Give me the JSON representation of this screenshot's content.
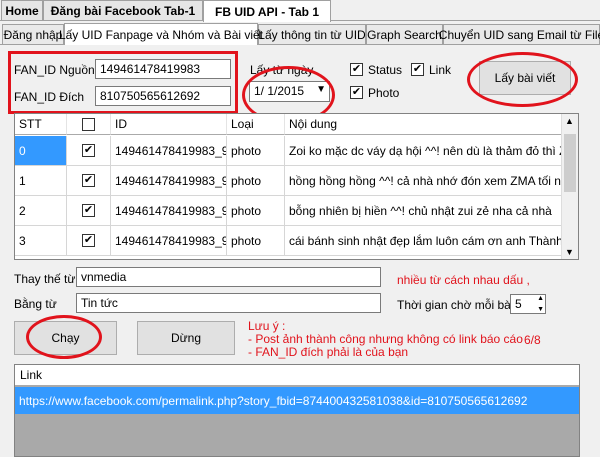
{
  "top_tabs": [
    "Home",
    "Đăng bài Facebook Tab-1",
    "FB UID API - Tab 1"
  ],
  "sub_tabs": [
    "Đăng nhập",
    "Lấy UID Fanpage và Nhóm và Bài viết",
    "Lấy thông tin từ UID",
    "Graph Search",
    "Chuyển UID sang Email từ File"
  ],
  "form": {
    "fan_id_source_label": "FAN_ID Nguồn",
    "fan_id_source_value": "149461478419983",
    "fan_id_dest_label": "FAN_ID Đích",
    "fan_id_dest_value": "810750565612692",
    "from_date_label": "Lấy từ ngày",
    "from_date_value": "1/  1/2015",
    "status_label": "Status",
    "link_label": "Link",
    "photo_label": "Photo",
    "get_posts_button": "Lấy bài viết"
  },
  "grid": {
    "headers": [
      "STT",
      "",
      "ID",
      "Loại",
      "Nội dung"
    ],
    "rows": [
      {
        "stt": "0",
        "id": "149461478419983_9...",
        "type": "photo",
        "content": "Zoi ko mặc dc váy dạ hội ^^! nên dù là thảm đỏ thì Z..."
      },
      {
        "stt": "1",
        "id": "149461478419983_9...",
        "type": "photo",
        "content": "hồng hồng hồng ^^! cả nhà nhớ đón xem ZMA tối na..."
      },
      {
        "stt": "2",
        "id": "149461478419983_9...",
        "type": "photo",
        "content": "bỗng nhiên bị hiền ^^! chủ nhật zui zẻ nha cả nhà"
      },
      {
        "stt": "3",
        "id": "149461478419983_9...",
        "type": "photo",
        "content": "cái bánh sinh nhật đẹp lắm luôn cám ơn anh Thành G..."
      }
    ]
  },
  "replace": {
    "replace_label": "Thay thế từ",
    "replace_value": "vnmedia",
    "with_label": "Bằng từ",
    "with_value": "Tin tức",
    "hint": "nhiều từ cách nhau dấu ,",
    "wait_label": "Thời gian chờ mỗi bài",
    "wait_value": "5"
  },
  "actions": {
    "run_button": "Chạy",
    "stop_button": "Dừng"
  },
  "notes": {
    "title": "Lưu ý :",
    "line1": "- Post ảnh thành công nhưng không có link báo cáo",
    "line2": "- FAN_ID đích phải là của bạn",
    "progress": "6/8"
  },
  "links": {
    "header": "Link",
    "rows": [
      "https://www.facebook.com/permalink.php?story_fbid=874400432581038&id=810750565612692"
    ]
  },
  "colors": {
    "annotation_red": "#e1131c",
    "selection_blue": "#3399ff"
  }
}
